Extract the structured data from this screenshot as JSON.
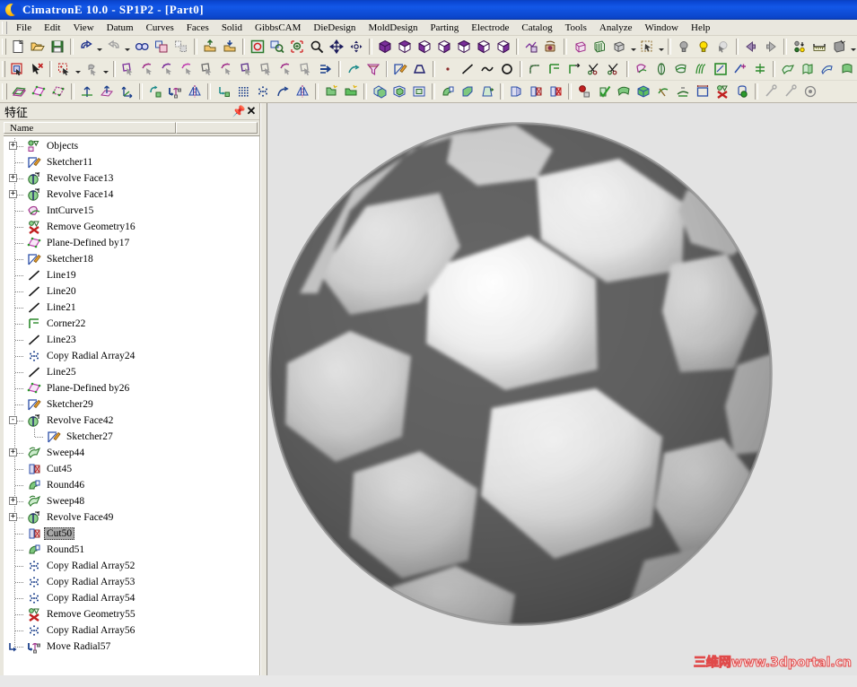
{
  "window": {
    "title": "CimatronE 10.0 - SP1P2 - [Part0]",
    "logo_icon": "cimatron-crescent-logo"
  },
  "menubar": {
    "items": [
      {
        "label": "File"
      },
      {
        "label": "Edit"
      },
      {
        "label": "View"
      },
      {
        "label": "Datum"
      },
      {
        "label": "Curves"
      },
      {
        "label": "Faces"
      },
      {
        "label": "Solid"
      },
      {
        "label": "GibbsCAM"
      },
      {
        "label": "DieDesign"
      },
      {
        "label": "MoldDesign"
      },
      {
        "label": "Parting"
      },
      {
        "label": "Electrode"
      },
      {
        "label": "Catalog"
      },
      {
        "label": "Tools"
      },
      {
        "label": "Analyze"
      },
      {
        "label": "Window"
      },
      {
        "label": "Help"
      }
    ]
  },
  "toolbars": {
    "row1": [
      {
        "icon": "new-document-icon"
      },
      {
        "icon": "open-folder-icon"
      },
      {
        "icon": "save-disk-icon"
      },
      {
        "sep": true
      },
      {
        "icon": "undo-icon",
        "dropdown": true
      },
      {
        "icon": "redo-icon",
        "dropdown": true
      },
      {
        "icon": "glasses-icon"
      },
      {
        "icon": "copy-objects-icon"
      },
      {
        "icon": "delete-objects-icon"
      },
      {
        "sep": true
      },
      {
        "icon": "import-icon"
      },
      {
        "icon": "export-icon"
      },
      {
        "sep": true
      },
      {
        "icon": "fit-screen-icon"
      },
      {
        "icon": "zoom-window-icon"
      },
      {
        "icon": "zoom-in-icon"
      },
      {
        "icon": "zoom-icon"
      },
      {
        "icon": "pan-icon"
      },
      {
        "icon": "rotate-icon"
      },
      {
        "sep": true
      },
      {
        "icon": "view-iso-icon"
      },
      {
        "icon": "view-top-icon"
      },
      {
        "icon": "view-front-icon"
      },
      {
        "icon": "view-right-icon"
      },
      {
        "icon": "view-bottom-icon"
      },
      {
        "icon": "view-back-icon"
      },
      {
        "icon": "view-left-icon"
      },
      {
        "sep": true
      },
      {
        "icon": "view-define-icon"
      },
      {
        "icon": "camera-view-icon"
      },
      {
        "sep": true
      },
      {
        "icon": "shade-icon"
      },
      {
        "icon": "transparent-icon"
      },
      {
        "icon": "render-mode-icon",
        "dropdown": true
      },
      {
        "icon": "box-select-icon",
        "dropdown": true
      },
      {
        "sep": true
      },
      {
        "icon": "light-off-icon"
      },
      {
        "icon": "light-on-icon"
      },
      {
        "icon": "light-pick-icon"
      },
      {
        "sep": true
      },
      {
        "icon": "prev-view-icon"
      },
      {
        "icon": "next-view-icon"
      },
      {
        "sep": true
      },
      {
        "icon": "attributes-icon"
      },
      {
        "icon": "measure-icon"
      },
      {
        "icon": "section-icon",
        "dropdown": true
      }
    ],
    "row2": [
      {
        "icon": "select-box-icon"
      },
      {
        "icon": "deselect-icon"
      },
      {
        "sep": true
      },
      {
        "icon": "selection-filter-icon",
        "dropdown": true
      },
      {
        "icon": "pick-filter-icon",
        "dropdown": true
      },
      {
        "sep": true
      },
      {
        "icon": "face-extend-icon"
      },
      {
        "icon": "face-trim-icon"
      },
      {
        "icon": "face-fillet-icon"
      },
      {
        "icon": "face-blend-icon"
      },
      {
        "icon": "face-remove-icon"
      },
      {
        "icon": "face-untrim-icon"
      },
      {
        "icon": "face-offset-icon"
      },
      {
        "icon": "face-split-icon"
      },
      {
        "icon": "face-match-icon"
      },
      {
        "icon": "face-curvature-icon"
      },
      {
        "icon": "face-sew-icon"
      },
      {
        "sep": true
      },
      {
        "icon": "curve-project-icon"
      },
      {
        "icon": "curve-funnel-icon"
      },
      {
        "sep": true
      },
      {
        "icon": "sketcher-icon"
      },
      {
        "icon": "profile-icon"
      },
      {
        "sep": true
      },
      {
        "icon": "point-icon"
      },
      {
        "icon": "line-icon"
      },
      {
        "icon": "arc-icon"
      },
      {
        "icon": "circle-icon"
      },
      {
        "sep": true
      },
      {
        "icon": "corner-round-icon"
      },
      {
        "icon": "corner-icon"
      },
      {
        "icon": "extend-curve-icon"
      },
      {
        "icon": "trim-scissors-icon"
      },
      {
        "icon": "break-scissors-icon"
      },
      {
        "sep": true
      },
      {
        "icon": "intersection-curve-icon"
      },
      {
        "icon": "silhouette-icon"
      },
      {
        "icon": "curve-on-face-icon"
      },
      {
        "icon": "isocurve-icon"
      },
      {
        "icon": "boundary-curve-icon"
      },
      {
        "icon": "curve-combine-icon"
      },
      {
        "icon": "curve-balance-icon"
      },
      {
        "sep": true
      },
      {
        "icon": "sweep-face-icon"
      },
      {
        "icon": "drive-face-icon"
      },
      {
        "icon": "ruled-face-icon"
      },
      {
        "icon": "fill-face-icon"
      }
    ],
    "row3": [
      {
        "icon": "plane-icon"
      },
      {
        "icon": "plane-defined-icon"
      },
      {
        "icon": "plane-3pt-icon"
      },
      {
        "sep": true
      },
      {
        "icon": "axis-icon"
      },
      {
        "icon": "axis-plane-icon"
      },
      {
        "icon": "ucs-icon"
      },
      {
        "sep": true
      },
      {
        "icon": "move-rotate-icon"
      },
      {
        "icon": "move-radial-icon"
      },
      {
        "icon": "mirror-icon"
      },
      {
        "sep": true
      },
      {
        "icon": "copy-move-icon"
      },
      {
        "icon": "copy-array-icon"
      },
      {
        "icon": "copy-radial-array-icon"
      },
      {
        "icon": "copy-curve-icon"
      },
      {
        "icon": "copy-mirror-icon"
      },
      {
        "sep": true
      },
      {
        "icon": "new-part-icon"
      },
      {
        "icon": "new-assembly-icon"
      },
      {
        "sep": true
      },
      {
        "icon": "add-body-icon"
      },
      {
        "icon": "subtract-body-icon"
      },
      {
        "icon": "intersect-body-icon"
      },
      {
        "sep": true
      },
      {
        "icon": "round-icon"
      },
      {
        "icon": "chamfer-icon"
      },
      {
        "icon": "draft-icon"
      },
      {
        "sep": true
      },
      {
        "icon": "shell-icon"
      },
      {
        "icon": "cut-icon"
      },
      {
        "icon": "cut-remove-icon"
      },
      {
        "sep": true
      },
      {
        "icon": "sphere-primitive-icon"
      },
      {
        "icon": "check-solid-icon"
      },
      {
        "icon": "thicken-icon"
      },
      {
        "icon": "solid-from-faces-icon"
      },
      {
        "icon": "trim-solid-icon"
      },
      {
        "icon": "split-solid-icon"
      },
      {
        "icon": "bounding-box-icon"
      },
      {
        "icon": "remove-geometry-icon"
      },
      {
        "icon": "volume-icon"
      },
      {
        "sep": true
      },
      {
        "icon": "pin-tool-icon"
      },
      {
        "icon": "pin-tool2-icon"
      },
      {
        "icon": "target-icon"
      }
    ]
  },
  "feature_panel": {
    "title": "特征",
    "pin_icon": "pin-icon",
    "close_icon": "close-icon",
    "column_header": "Name",
    "tree": [
      {
        "label": "Objects",
        "icon": "objects-icon",
        "level": 1,
        "expander": "+",
        "selected": false
      },
      {
        "label": "Sketcher11",
        "icon": "sketcher-icon",
        "level": 1,
        "expander": "",
        "selected": false
      },
      {
        "label": "Revolve Face13",
        "icon": "revolve-face-icon",
        "level": 1,
        "expander": "+",
        "selected": false
      },
      {
        "label": "Revolve Face14",
        "icon": "revolve-face-icon",
        "level": 1,
        "expander": "+",
        "selected": false
      },
      {
        "label": "IntCurve15",
        "icon": "intcurve-icon",
        "level": 1,
        "expander": "",
        "selected": false
      },
      {
        "label": "Remove Geometry16",
        "icon": "remove-geometry-icon",
        "level": 1,
        "expander": "",
        "selected": false
      },
      {
        "label": "Plane-Defined by17",
        "icon": "plane-defined-icon",
        "level": 1,
        "expander": "",
        "selected": false
      },
      {
        "label": "Sketcher18",
        "icon": "sketcher-icon",
        "level": 1,
        "expander": "",
        "selected": false
      },
      {
        "label": "Line19",
        "icon": "line-icon",
        "level": 1,
        "expander": "",
        "selected": false
      },
      {
        "label": "Line20",
        "icon": "line-icon",
        "level": 1,
        "expander": "",
        "selected": false
      },
      {
        "label": "Line21",
        "icon": "line-icon",
        "level": 1,
        "expander": "",
        "selected": false
      },
      {
        "label": "Corner22",
        "icon": "corner-icon",
        "level": 1,
        "expander": "",
        "selected": false
      },
      {
        "label": "Line23",
        "icon": "line-icon",
        "level": 1,
        "expander": "",
        "selected": false
      },
      {
        "label": "Copy Radial Array24",
        "icon": "copy-radial-icon",
        "level": 1,
        "expander": "",
        "selected": false
      },
      {
        "label": "Line25",
        "icon": "line-icon",
        "level": 1,
        "expander": "",
        "selected": false
      },
      {
        "label": "Plane-Defined by26",
        "icon": "plane-defined-icon",
        "level": 1,
        "expander": "",
        "selected": false
      },
      {
        "label": "Sketcher29",
        "icon": "sketcher-icon",
        "level": 1,
        "expander": "",
        "selected": false
      },
      {
        "label": "Revolve Face42",
        "icon": "revolve-face-icon",
        "level": 1,
        "expander": "-",
        "selected": false
      },
      {
        "label": "Sketcher27",
        "icon": "sketcher-icon",
        "level": 2,
        "expander": "",
        "selected": false
      },
      {
        "label": "Sweep44",
        "icon": "sweep-icon",
        "level": 1,
        "expander": "+",
        "selected": false
      },
      {
        "label": "Cut45",
        "icon": "cut-icon",
        "level": 1,
        "expander": "",
        "selected": false
      },
      {
        "label": "Round46",
        "icon": "round-icon",
        "level": 1,
        "expander": "",
        "selected": false
      },
      {
        "label": "Sweep48",
        "icon": "sweep-icon",
        "level": 1,
        "expander": "+",
        "selected": false
      },
      {
        "label": "Revolve Face49",
        "icon": "revolve-face-icon",
        "level": 1,
        "expander": "+",
        "selected": false
      },
      {
        "label": "Cut50",
        "icon": "cut-icon",
        "level": 1,
        "expander": "",
        "selected": true
      },
      {
        "label": "Round51",
        "icon": "round-icon",
        "level": 1,
        "expander": "",
        "selected": false
      },
      {
        "label": "Copy Radial Array52",
        "icon": "copy-radial-icon",
        "level": 1,
        "expander": "",
        "selected": false
      },
      {
        "label": "Copy Radial Array53",
        "icon": "copy-radial-icon",
        "level": 1,
        "expander": "",
        "selected": false
      },
      {
        "label": "Copy Radial Array54",
        "icon": "copy-radial-icon",
        "level": 1,
        "expander": "",
        "selected": false
      },
      {
        "label": "Remove Geometry55",
        "icon": "remove-geometry-icon",
        "level": 1,
        "expander": "",
        "selected": false
      },
      {
        "label": "Copy Radial Array56",
        "icon": "copy-radial-icon",
        "level": 1,
        "expander": "",
        "selected": false
      },
      {
        "label": "Move Radial57",
        "icon": "move-radial-icon",
        "level": 1,
        "expander": "",
        "selected": false,
        "last": true
      }
    ]
  },
  "viewport": {
    "model_name": "soccer-ball-model",
    "background_color": "#e3e3e3",
    "watermark": "三维网www.3dportal.cn",
    "watermark_color": "#e04a4a"
  },
  "colors": {
    "titlebar": "#0f4bd6",
    "toolbar_bg": "#eceadf",
    "panel_bg": "#e9e7de",
    "tree_bg": "#ffffff",
    "selection": "#a8a8a8",
    "viewport_bg": "#e3e3e3"
  }
}
